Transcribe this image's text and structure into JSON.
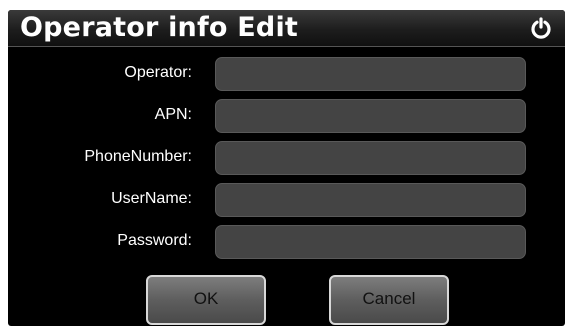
{
  "window": {
    "title": "Operator info Edit"
  },
  "icons": {
    "power": "power-icon"
  },
  "form": {
    "fields": [
      {
        "label": "Operator:",
        "value": ""
      },
      {
        "label": "APN:",
        "value": ""
      },
      {
        "label": "PhoneNumber:",
        "value": ""
      },
      {
        "label": "UserName:",
        "value": ""
      },
      {
        "label": "Password:",
        "value": ""
      }
    ]
  },
  "buttons": {
    "ok": "OK",
    "cancel": "Cancel"
  },
  "colors": {
    "background": "#000000",
    "field": "#444444",
    "text": "#ffffff"
  }
}
